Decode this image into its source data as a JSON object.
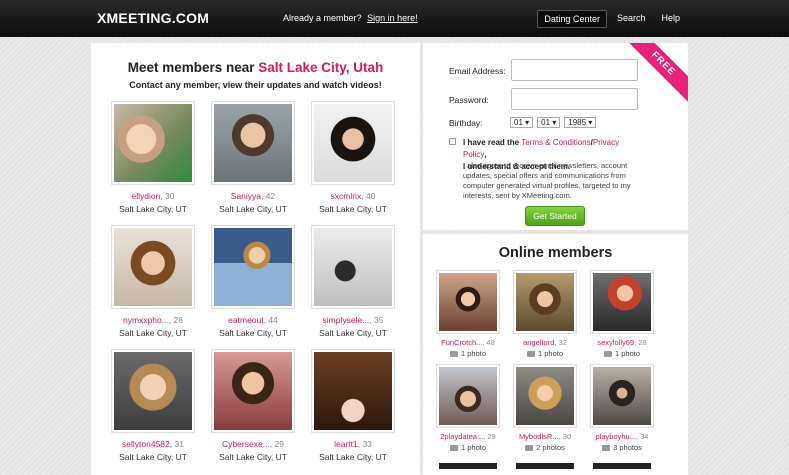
{
  "header": {
    "logo": "XMEETING.COM",
    "member_question": "Already a member?",
    "sign_in_link": "Sign in here!",
    "nav": [
      {
        "label": "Dating Center",
        "active": true
      },
      {
        "label": "Search",
        "active": false
      },
      {
        "label": "Help",
        "active": false
      }
    ]
  },
  "left": {
    "title_prefix": "Meet members near",
    "city": "Salt Lake City, Utah",
    "subtitle": "Contact any member, view their updates and watch videos!",
    "members": [
      {
        "name": "ellydion",
        "age": ", 30",
        "location": "Salt Lake City, UT"
      },
      {
        "name": "Saniyya",
        "age": ", 42",
        "location": "Salt Lake City, UT"
      },
      {
        "name": "sxcmlnx",
        "age": ", 40",
        "location": "Salt Lake City, UT"
      },
      {
        "name": "nymxxpho...",
        "age": ", 28",
        "location": "Salt Lake City, UT"
      },
      {
        "name": "eatmeout",
        "age": ", 44",
        "location": "Salt Lake City, UT"
      },
      {
        "name": "simplysele...",
        "age": ", 35",
        "location": "Salt Lake City, UT"
      },
      {
        "name": "sellyton4582",
        "age": ", 31",
        "location": "Salt Lake City, UT"
      },
      {
        "name": "Cybersexe...",
        "age": ", 29",
        "location": "Salt Lake City, UT"
      },
      {
        "name": "leartt1",
        "age": ", 33",
        "location": "Salt Lake City, UT"
      }
    ]
  },
  "register": {
    "ribbon": "FREE",
    "email_label": "Email Address:",
    "password_label": "Password:",
    "birthday_label": "Birthday:",
    "birthday_month": "01 ▾",
    "birthday_day": "01 ▾",
    "birthday_year": "1985 ▾",
    "terms_prefix": "I have read the",
    "terms_link": "Terms & Conditions",
    "slash": "/",
    "privacy_link": "Privacy Policy",
    "terms_suffix": ",",
    "accept": "I understand & accept them.",
    "legal": "I also agree to receive email newsletters, account updates, special offers and communications from computer generated virtual profiles, targeted to my interests, sent by XMeeting.com.",
    "button": "Get Started"
  },
  "online": {
    "title": "Online members",
    "members": [
      {
        "name": "FunCrotch...",
        "age": ", 48",
        "photos": "1 photo"
      },
      {
        "name": "angelIord",
        "age": ", 32",
        "photos": "1 photo"
      },
      {
        "name": "sexylolly69",
        "age": ", 28",
        "photos": "1 photo"
      },
      {
        "name": "2playdatea...",
        "age": ", 29",
        "photos": "1 photo"
      },
      {
        "name": "MybodlsR...",
        "age": ", 30",
        "photos": "2 photos"
      },
      {
        "name": "playboyhu...",
        "age": ", 34",
        "photos": "3 photos"
      }
    ]
  }
}
